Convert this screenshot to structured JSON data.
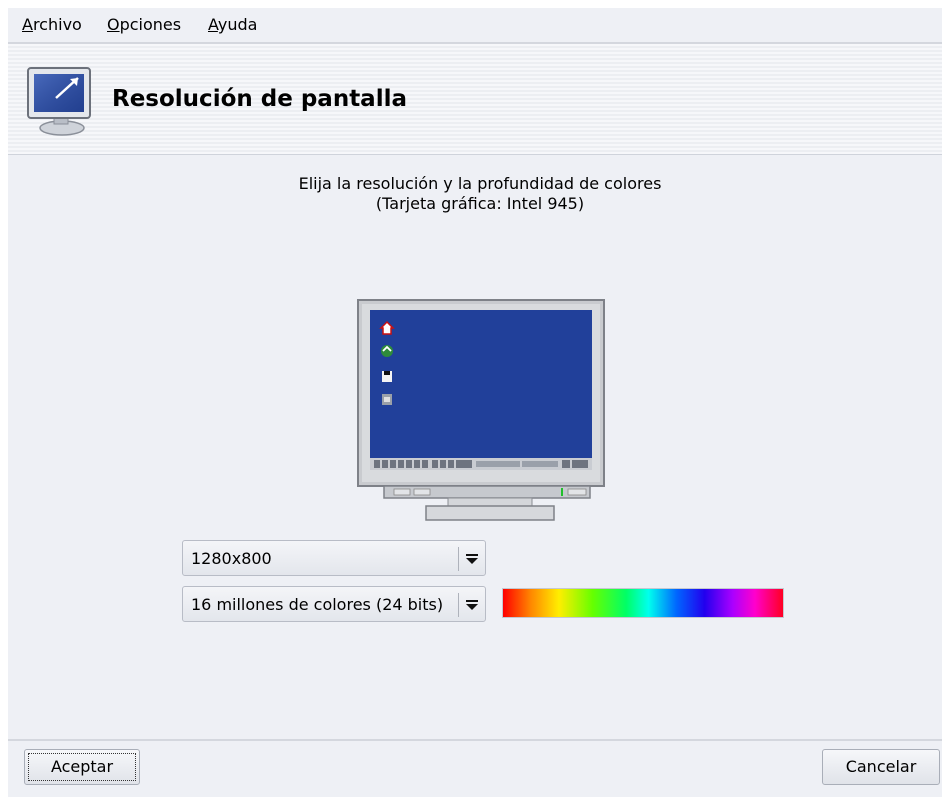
{
  "menubar": {
    "items": [
      {
        "accel": "A",
        "rest": "rchivo"
      },
      {
        "accel": "O",
        "rest": "pciones"
      },
      {
        "accel": "A",
        "rest": "yuda"
      }
    ]
  },
  "header": {
    "title": "Resolución de pantalla",
    "icon": "monitor-icon"
  },
  "instructions": {
    "line1": "Elija la resolución y la profundidad de colores",
    "line2": "(Tarjeta gráfica: Intel 945)"
  },
  "resolution": {
    "selected": "1280x800"
  },
  "color_depth": {
    "selected": "16 millones de colores (24 bits)"
  },
  "buttons": {
    "accept": "Aceptar",
    "cancel": "Cancelar"
  },
  "colors": {
    "window_bg": "#eef0f5",
    "monitor_screen": "#21409a"
  }
}
